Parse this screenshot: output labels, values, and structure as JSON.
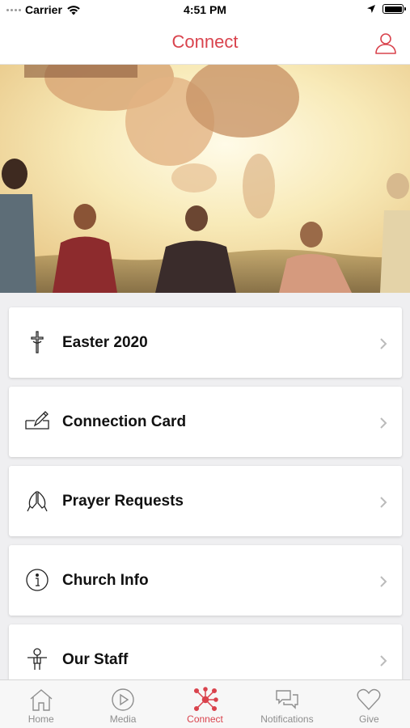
{
  "status_bar": {
    "carrier": "Carrier",
    "time": "4:51 PM"
  },
  "nav": {
    "title": "Connect"
  },
  "menu": {
    "items": [
      {
        "label": "Easter 2020",
        "icon": "cross-icon"
      },
      {
        "label": "Connection Card",
        "icon": "card-pen-icon"
      },
      {
        "label": "Prayer Requests",
        "icon": "praying-hands-icon"
      },
      {
        "label": "Church Info",
        "icon": "info-icon"
      },
      {
        "label": "Our Staff",
        "icon": "staff-person-icon"
      }
    ]
  },
  "tabs": [
    {
      "label": "Home",
      "icon": "home-icon",
      "active": false
    },
    {
      "label": "Media",
      "icon": "play-icon",
      "active": false
    },
    {
      "label": "Connect",
      "icon": "connect-network-icon",
      "active": true
    },
    {
      "label": "Notifications",
      "icon": "chat-bubbles-icon",
      "active": false
    },
    {
      "label": "Give",
      "icon": "heart-icon",
      "active": false
    }
  ],
  "colors": {
    "accent": "#d9434d",
    "tab_inactive": "#8e8e8e",
    "background": "#efeff1"
  }
}
